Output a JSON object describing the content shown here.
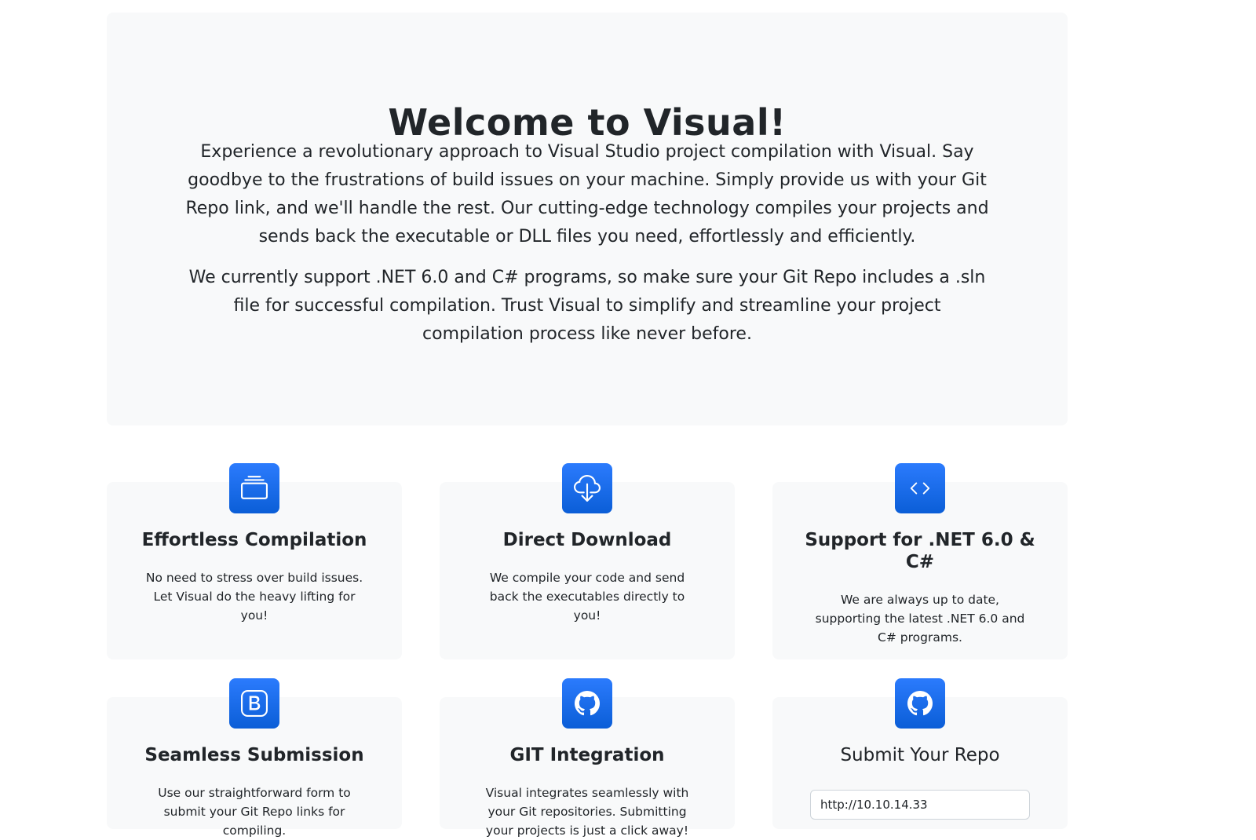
{
  "hero": {
    "title": "Welcome to Visual!",
    "paragraph1": "Experience a revolutionary approach to Visual Studio project compilation with Visual. Say goodbye to the frustrations of build issues on your machine. Simply provide us with your Git Repo link, and we'll handle the rest. Our cutting-edge technology compiles your projects and sends back the executable or DLL files you need, effortlessly and efficiently.",
    "paragraph2": "We currently support .NET 6.0 and C# programs, so make sure your Git Repo includes a .sln file for successful compilation. Trust Visual to simplify and streamline your project compilation process like never before."
  },
  "features": [
    {
      "icon": "collection-icon",
      "title": "Effortless Compilation",
      "description": "No need to stress over build issues. Let Visual do the heavy lifting for you!"
    },
    {
      "icon": "cloud-download-icon",
      "title": "Direct Download",
      "description": "We compile your code and send back the executables directly to you!"
    },
    {
      "icon": "code-icon",
      "title": "Support for .NET 6.0 & C#",
      "description": "We are always up to date, supporting the latest .NET 6.0 and C# programs."
    },
    {
      "icon": "bootstrap-icon",
      "title": "Seamless Submission",
      "description": "Use our straightforward form to submit your Git Repo links for compiling."
    },
    {
      "icon": "github-icon",
      "title": "GIT Integration",
      "description": "Visual integrates seamlessly with your Git repositories. Submitting your projects is just a click away!"
    }
  ],
  "submit": {
    "icon": "github-icon",
    "title": "Submit Your Repo",
    "input_value": "http://10.10.14.33"
  },
  "colors": {
    "accent": "#0d6efd",
    "card_background": "#f8f9fa",
    "text": "#212529"
  }
}
